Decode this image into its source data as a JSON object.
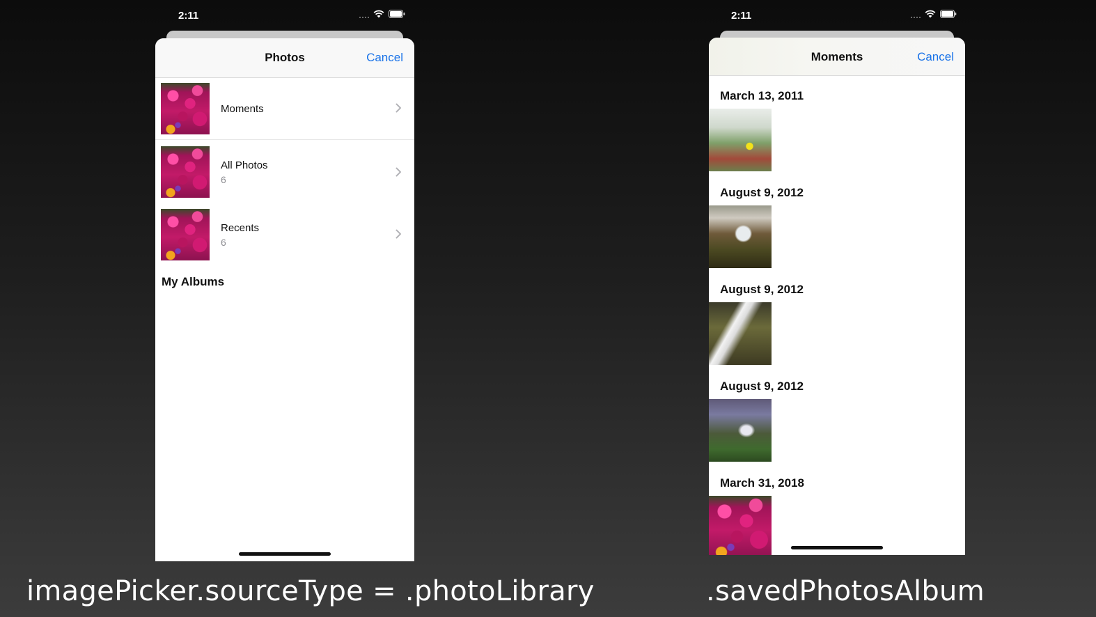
{
  "left": {
    "status_time": "2:11",
    "nav_title": "Photos",
    "cancel_label": "Cancel",
    "albums": [
      {
        "name": "Moments",
        "count": ""
      },
      {
        "name": "All Photos",
        "count": "6"
      },
      {
        "name": "Recents",
        "count": "6"
      }
    ],
    "section_header": "My Albums"
  },
  "right": {
    "status_time": "2:11",
    "nav_title": "Moments",
    "cancel_label": "Cancel",
    "moments": [
      {
        "date": "March 13, 2011"
      },
      {
        "date": "August 9, 2012"
      },
      {
        "date": "August 9, 2012"
      },
      {
        "date": "August 9, 2012"
      },
      {
        "date": "March 31, 2018"
      }
    ]
  },
  "captions": {
    "left": "imagePicker.sourceType = .photoLibrary",
    "right": ".savedPhotosAlbum"
  },
  "colors": {
    "accent": "#1a73e8",
    "flower_pink": "#c21a68"
  },
  "icons": [
    "wifi-icon",
    "battery-icon",
    "chevron-right-icon"
  ]
}
